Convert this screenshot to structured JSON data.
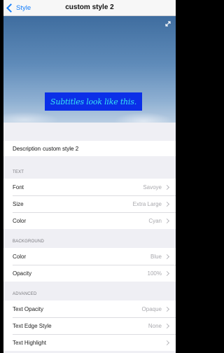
{
  "nav": {
    "back_label": "Style",
    "title": "custom style 2"
  },
  "preview": {
    "subtitle_text": "Subtitles look like this.",
    "box_color": "#0b2fe8",
    "text_color": "#37e6f2"
  },
  "description": {
    "label": "Description",
    "value": "custom style 2"
  },
  "sections": {
    "text": {
      "header": "TEXT",
      "rows": [
        {
          "label": "Font",
          "value": "Savoye"
        },
        {
          "label": "Size",
          "value": "Extra Large"
        },
        {
          "label": "Color",
          "value": "Cyan"
        }
      ]
    },
    "background": {
      "header": "BACKGROUND",
      "rows": [
        {
          "label": "Color",
          "value": "Blue"
        },
        {
          "label": "Opacity",
          "value": "100%"
        }
      ]
    },
    "advanced": {
      "header": "ADVANCED",
      "rows": [
        {
          "label": "Text Opacity",
          "value": "Opaque"
        },
        {
          "label": "Text Edge Style",
          "value": "None"
        },
        {
          "label": "Text Highlight",
          "value": ""
        }
      ]
    }
  },
  "colors": {
    "accent": "#147efb"
  }
}
